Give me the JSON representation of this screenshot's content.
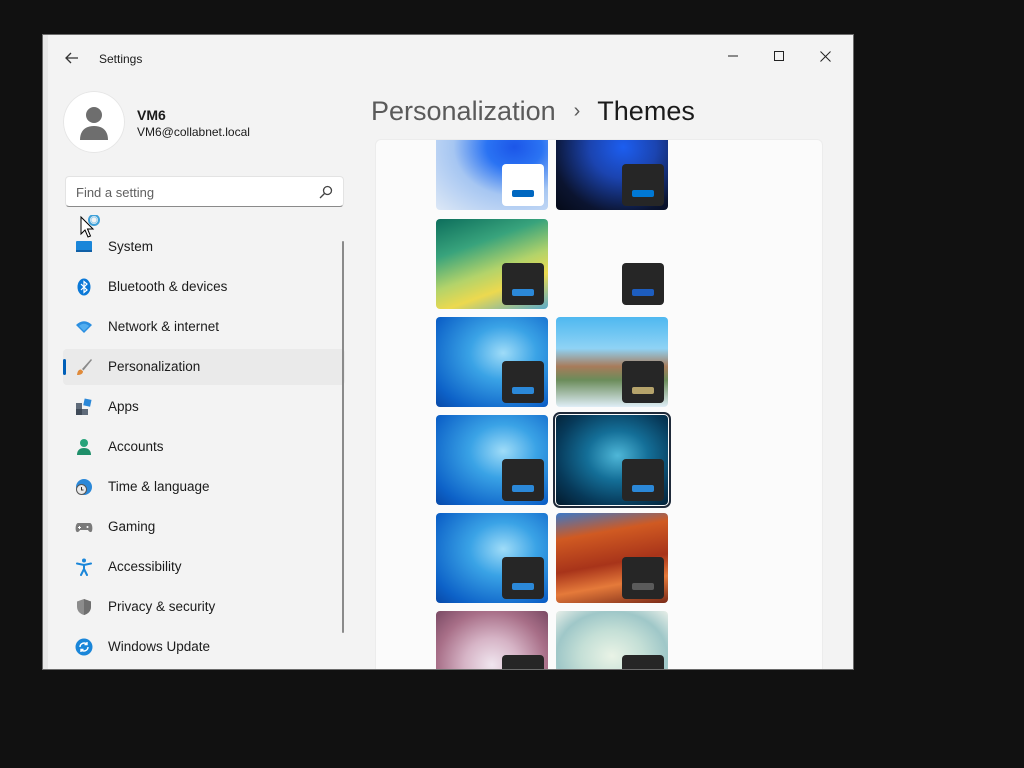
{
  "window": {
    "title": "Settings",
    "controls": {
      "minimize": "–",
      "maximize": "□",
      "close": "✕"
    }
  },
  "user": {
    "name": "VM6",
    "email": "VM6@collabnet.local"
  },
  "search": {
    "placeholder": "Find a setting"
  },
  "nav": {
    "items": [
      {
        "label": "System",
        "icon": "system-icon",
        "active": false
      },
      {
        "label": "Bluetooth & devices",
        "icon": "bluetooth-icon",
        "active": false
      },
      {
        "label": "Network & internet",
        "icon": "network-icon",
        "active": false
      },
      {
        "label": "Personalization",
        "icon": "paintbrush-icon",
        "active": true
      },
      {
        "label": "Apps",
        "icon": "apps-icon",
        "active": false
      },
      {
        "label": "Accounts",
        "icon": "accounts-icon",
        "active": false
      },
      {
        "label": "Time & language",
        "icon": "globe-clock-icon",
        "active": false
      },
      {
        "label": "Gaming",
        "icon": "gamepad-icon",
        "active": false
      },
      {
        "label": "Accessibility",
        "icon": "accessibility-icon",
        "active": false
      },
      {
        "label": "Privacy & security",
        "icon": "shield-icon",
        "active": false
      },
      {
        "label": "Windows Update",
        "icon": "update-icon",
        "active": false
      }
    ]
  },
  "header": {
    "parent": "Personalization",
    "separator": "›",
    "current": "Themes"
  },
  "themes": [
    {
      "name": "windows-light",
      "taskbar": "light",
      "accent": "#0067c0"
    },
    {
      "name": "windows-dark",
      "taskbar": "dark",
      "accent": "#0078d4"
    },
    {
      "name": "vista-green",
      "taskbar": "dark",
      "accent": "#2b88d8"
    },
    {
      "name": "blank",
      "taskbar": "dark",
      "accent": "#1d5dbf"
    },
    {
      "name": "windows7-blue-1",
      "taskbar": "dark",
      "accent": "#2b88d8"
    },
    {
      "name": "turtle-island",
      "taskbar": "dark",
      "accent": "#b5a36b"
    },
    {
      "name": "windows7-blue-2",
      "taskbar": "dark",
      "accent": "#2b88d8"
    },
    {
      "name": "windows7-dark",
      "taskbar": "dark",
      "accent": "#2b88d8",
      "selected": true
    },
    {
      "name": "windows7-blue-3",
      "taskbar": "dark",
      "accent": "#2b88d8"
    },
    {
      "name": "red-canyon",
      "taskbar": "dark",
      "accent": "#5a5a5a"
    },
    {
      "name": "pink-flower",
      "taskbar": "dark",
      "accent": "#2b88d8"
    },
    {
      "name": "glass-art",
      "taskbar": "dark",
      "accent": "#2b88d8"
    }
  ]
}
